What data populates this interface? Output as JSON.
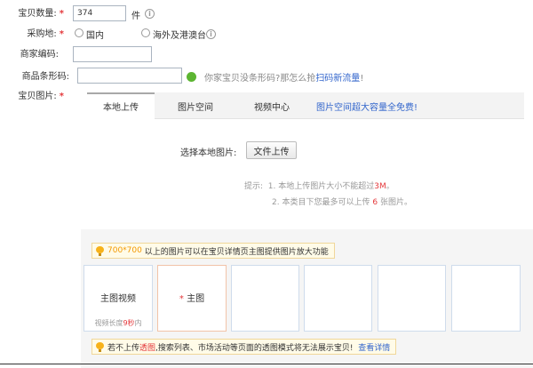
{
  "form": {
    "quantity": {
      "label": "宝贝数量:",
      "value": "374",
      "unit": "件"
    },
    "origin": {
      "label": "采购地:",
      "options": [
        {
          "label": "国内"
        },
        {
          "label": "海外及港澳台"
        }
      ]
    },
    "merchant_code": {
      "label": "商家编码:",
      "value": ""
    },
    "barcode": {
      "label": "商品条形码:",
      "value": "",
      "hint_prefix": "你家宝贝没条形码?",
      "hint_mid": "那怎么抢",
      "hint_link": "扫码新流量",
      "hint_suffix": "!"
    },
    "images_label": "宝贝图片:",
    "required_mark": "*"
  },
  "image_uploader": {
    "tabs": [
      {
        "label": "本地上传"
      },
      {
        "label": "图片空间"
      },
      {
        "label": "视频中心"
      }
    ],
    "promo_text": "图片空间超大容量全免费!",
    "select_label": "选择本地图片:",
    "upload_button": "文件上传",
    "tips": {
      "prefix": "提示:",
      "tip1_num": "1.",
      "tip1_text": "本地上传图片大小不能超过",
      "tip1_value": "3M",
      "tip1_end": "。",
      "tip2_num": "2.",
      "tip2_text": "本类目下您最多可以上传",
      "tip2_value": "6",
      "tip2_end": "张图片。"
    },
    "notice_top": {
      "highlight": "700*700",
      "text": "以上的图片可以在宝贝详情页主图提供图片放大功能"
    },
    "slots": [
      {
        "label": "主图视频",
        "sub_prefix": "视频长度",
        "sub_value": "9秒",
        "sub_suffix": "内"
      },
      {
        "label": "主图",
        "mark": "*"
      },
      {
        "label": ""
      },
      {
        "label": ""
      },
      {
        "label": ""
      },
      {
        "label": ""
      }
    ],
    "notice_bottom": {
      "prefix": "若不上传",
      "highlight": "透图",
      "text": ",搜索列表、市场活动等页面的透图模式将无法展示宝贝!",
      "link": "查看详情"
    }
  },
  "colors": {
    "required": "#e4393c",
    "link": "#3366cc",
    "accent_orange": "#f39800",
    "ok_green": "#5cb532"
  }
}
